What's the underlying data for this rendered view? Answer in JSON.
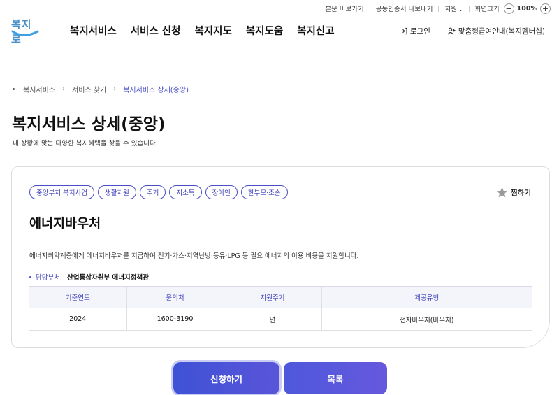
{
  "util": {
    "skip_link": "본문 바로가기",
    "cert_export": "공동인증서 내보내기",
    "region": "지원",
    "font_size_label": "화면크기",
    "zoom_minus": "−",
    "zoom_value": "100%",
    "zoom_plus": "+"
  },
  "logo": {
    "text": "복지로"
  },
  "gnb": [
    "복지서비스",
    "서비스 신청",
    "복지지도",
    "복지도움",
    "복지신고"
  ],
  "header_right": {
    "login": "로그인",
    "member": "맞춤형급여안내(복지멤버십)"
  },
  "breadcrumb": [
    "복지서비스",
    "서비스 찾기",
    "복지서비스 상세(중앙)"
  ],
  "page": {
    "title": "복지서비스 상세(중앙)",
    "description": "내 상황에 맞는 다양한 복지혜택을 찾을 수 있습니다."
  },
  "card": {
    "tags": [
      "중앙부처 복지사업",
      "생활지원",
      "주거",
      "저소득",
      "장애인",
      "한부모·조손"
    ],
    "favorite_label": "찜하기",
    "title": "에너지바우처",
    "description": "에너지취약계층에게 에너지바우처를 지급하여 전기·가스·지역난방·등유·LPG 등 필요 에너지의 이용 비용을 지원합니다.",
    "dept_label": "담당부처",
    "dept_value": "산업통상자원부 에너지정책관",
    "table": {
      "headers": [
        "기준연도",
        "문의처",
        "지원주기",
        "제공유형"
      ],
      "rows": [
        [
          "2024",
          "1600-3190",
          "년",
          "전자바우처(바우처)"
        ]
      ]
    }
  },
  "buttons": {
    "apply": "신청하기",
    "list": "목록"
  },
  "colors": {
    "accent": "#4a4fc9",
    "tag_text": "#3d3fb8",
    "table_head_bg": "#f4f5fa"
  }
}
